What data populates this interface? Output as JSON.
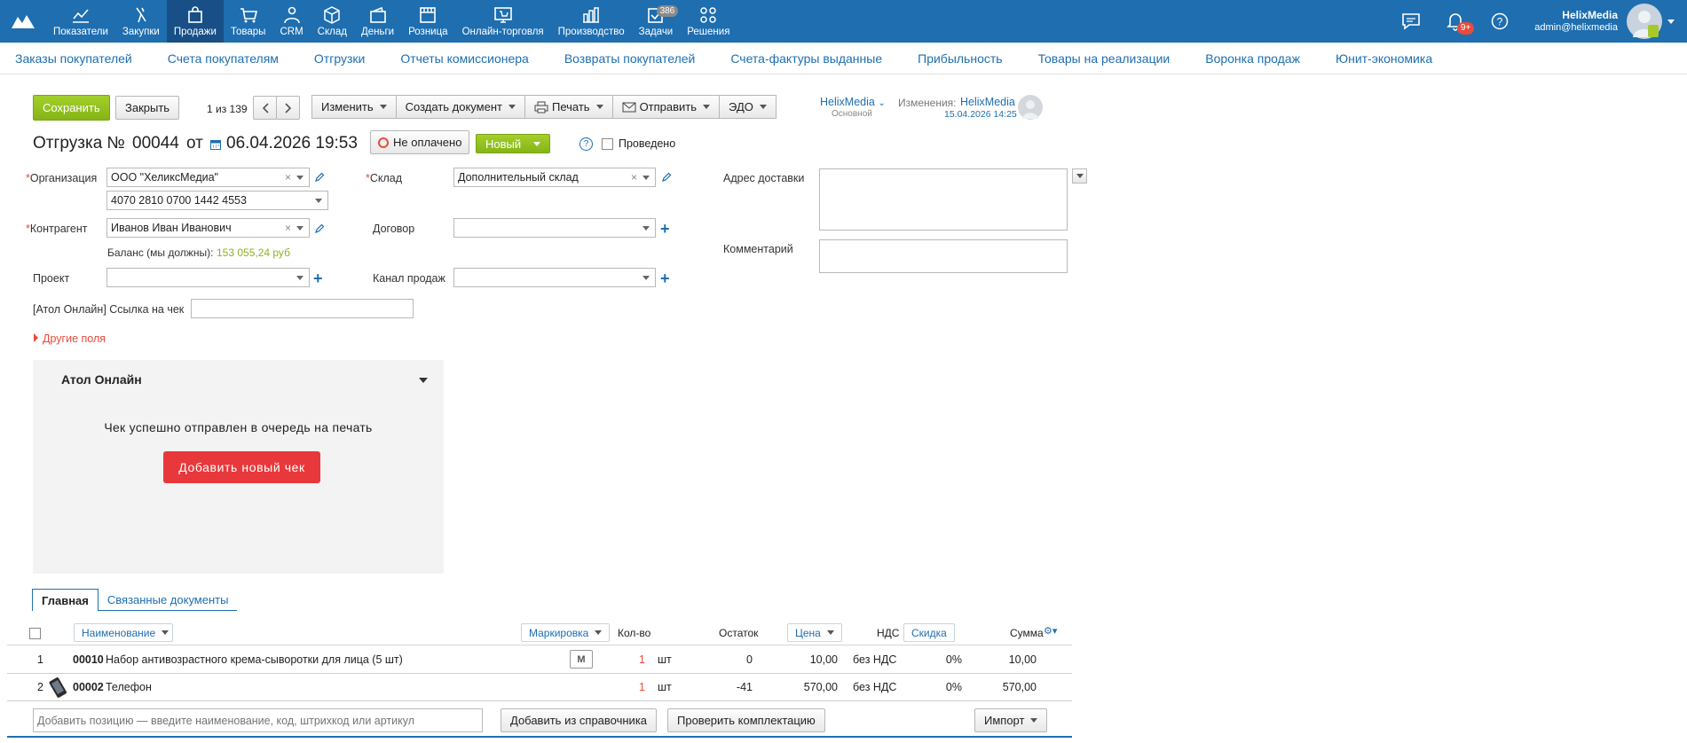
{
  "nav": {
    "items": [
      {
        "label": "Показатели",
        "icon": "chart-line-icon"
      },
      {
        "label": "Закупки",
        "icon": "purchases-icon"
      },
      {
        "label": "Продажи",
        "icon": "bag-icon",
        "active": true
      },
      {
        "label": "Товары",
        "icon": "cart-icon"
      },
      {
        "label": "CRM",
        "icon": "people-icon"
      },
      {
        "label": "Склад",
        "icon": "box-icon"
      },
      {
        "label": "Деньги",
        "icon": "wallet-icon"
      },
      {
        "label": "Розница",
        "icon": "store-icon"
      },
      {
        "label": "Онлайн-торговля",
        "icon": "online-store-icon"
      },
      {
        "label": "Производство",
        "icon": "factory-icon"
      },
      {
        "label": "Задачи",
        "icon": "tasks-icon",
        "badge": "386"
      },
      {
        "label": "Решения",
        "icon": "apps-icon"
      }
    ],
    "notifications_badge": "9+",
    "user_name": "HelixMedia",
    "user_email": "admin@helixmedia"
  },
  "subnav": [
    "Заказы покупателей",
    "Счета покупателям",
    "Отгрузки",
    "Отчеты комиссионера",
    "Возвраты покупателей",
    "Счета-фактуры выданные",
    "Прибыльность",
    "Товары на реализации",
    "Воронка продаж",
    "Юнит-экономика"
  ],
  "toolbar": {
    "save": "Сохранить",
    "close": "Закрыть",
    "pager": "1 из 139",
    "change": "Изменить",
    "create_doc": "Создать документ",
    "print": "Печать",
    "send": "Отправить",
    "edo": "ЭДО",
    "owner": "HelixMedia",
    "owner_sub": "Основной",
    "changes_label": "Изменения:",
    "changes_user": "HelixMedia",
    "changes_date": "15.04.2026 14:25"
  },
  "doc": {
    "title": "Отгрузка №",
    "number": "00044",
    "from": "от",
    "date": "06.04.2026 19:53",
    "payment_status": "Не оплачено",
    "status": "Новый",
    "help": "?",
    "posted_label": "Проведено"
  },
  "form": {
    "org_label": "Организация",
    "org_value": "ООО \"ХеликсМедиа\"",
    "account_value": "4070 2810 0700 1442 4553",
    "warehouse_label": "Склад",
    "warehouse_value": "Дополнительный склад",
    "delivery_label": "Адрес доставки",
    "counterparty_label": "Контрагент",
    "counterparty_value": "Иванов Иван Иванович",
    "contract_label": "Договор",
    "comment_label": "Комментарий",
    "balance_label": "Баланс (мы должны):",
    "balance_value": "153 055,24 руб",
    "project_label": "Проект",
    "channel_label": "Канал продаж",
    "atol_link_label": "[Атол Онлайн] Ссылка на чек",
    "other_fields": "Другие поля",
    "required_mark": "*",
    "clear_mark": "×"
  },
  "atol": {
    "title": "Атол Онлайн",
    "message": "Чек успешно отправлен в очередь на печать",
    "add_button": "Добавить новый чек"
  },
  "tabs": [
    "Главная",
    "Связанные документы"
  ],
  "table": {
    "headers": {
      "name": "Наименование",
      "marking": "Маркировка",
      "qty": "Кол-во",
      "stock": "Остаток",
      "price": "Цена",
      "vat": "НДС",
      "discount": "Скидка",
      "sum": "Сумма"
    },
    "rows": [
      {
        "n": "1",
        "code": "00010",
        "name": "Набор антивозрастного крема-сыворотки для лица (5 шт)",
        "mark": "M",
        "qty": "1",
        "unit": "шт",
        "stock": "0",
        "price": "10,00",
        "vat": "без НДС",
        "discount": "0%",
        "sum": "10,00"
      },
      {
        "n": "2",
        "code": "00002",
        "name": "Телефон",
        "mark": "",
        "qty": "1",
        "unit": "шт",
        "stock": "-41",
        "price": "570,00",
        "vat": "без НДС",
        "discount": "0%",
        "sum": "570,00"
      }
    ]
  },
  "bottom": {
    "add_placeholder": "Добавить позицию — введите наименование, код, штрихкод или артикул",
    "add_from_catalog": "Добавить из справочника",
    "check_kit": "Проверить комплектацию",
    "import": "Импорт"
  }
}
